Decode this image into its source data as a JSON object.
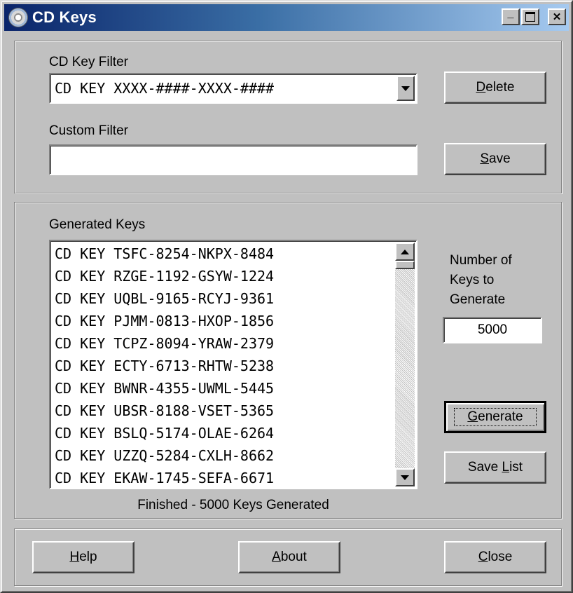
{
  "window": {
    "title": "CD Keys",
    "controls": {
      "minimize": "_",
      "maximize": "□",
      "close": "✕"
    }
  },
  "filter": {
    "cd_key_filter_label": "CD Key Filter",
    "cd_key_filter_value": "CD KEY XXXX-####-XXXX-####",
    "custom_filter_label": "Custom Filter",
    "custom_filter_value": "",
    "delete_button": {
      "hotkey": "D",
      "rest": "elete"
    },
    "save_button": {
      "hotkey": "S",
      "rest": "ave"
    }
  },
  "generated": {
    "label": "Generated Keys",
    "keys": [
      "CD KEY TSFC-8254-NKPX-8484",
      "CD KEY RZGE-1192-GSYW-1224",
      "CD KEY UQBL-9165-RCYJ-9361",
      "CD KEY PJMM-0813-HXOP-1856",
      "CD KEY TCPZ-8094-YRAW-2379",
      "CD KEY ECTY-6713-RHTW-5238",
      "CD KEY BWNR-4355-UWML-5445",
      "CD KEY UBSR-8188-VSET-5365",
      "CD KEY BSLQ-5174-OLAE-6264",
      "CD KEY UZZQ-5284-CXLH-8662",
      "CD KEY EKAW-1745-SEFA-6671"
    ],
    "count_label_lines": [
      "Number of",
      "Keys to",
      "Generate"
    ],
    "count_value": "5000",
    "generate_button": {
      "hotkey": "G",
      "rest": "enerate"
    },
    "save_list_button": {
      "before": "Save ",
      "hotkey": "L",
      "rest": "ist"
    },
    "status": "Finished - 5000 Keys Generated"
  },
  "footer": {
    "help_button": {
      "hotkey": "H",
      "rest": "elp"
    },
    "about_button": {
      "hotkey": "A",
      "rest": "bout"
    },
    "close_button": {
      "hotkey": "C",
      "rest": "lose"
    }
  }
}
